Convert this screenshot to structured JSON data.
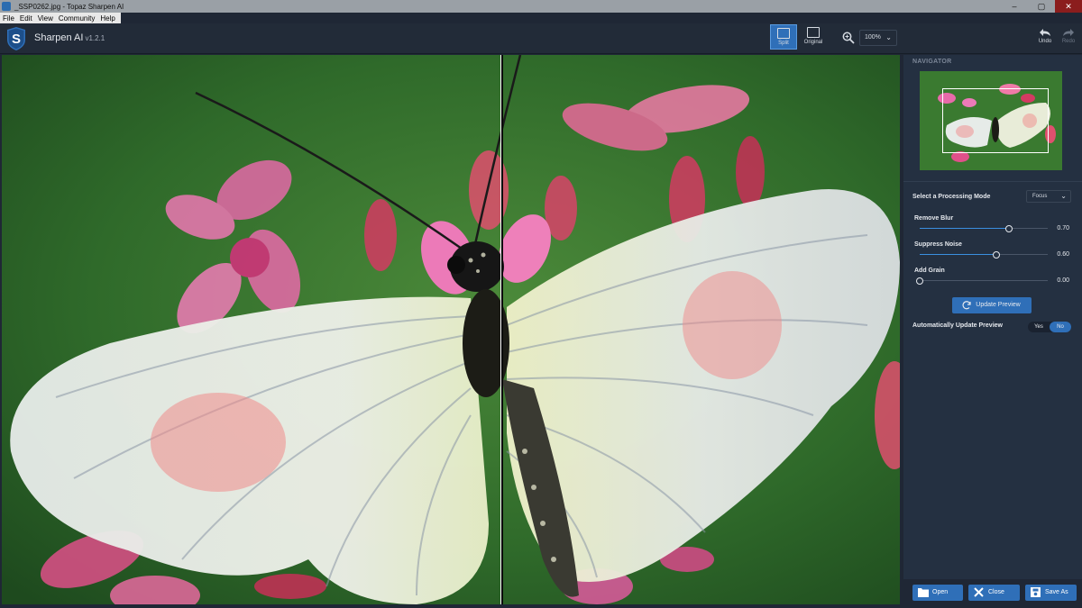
{
  "window": {
    "title": "_SSP0262.jpg - Topaz Sharpen AI",
    "controls": {
      "minimize": "–",
      "maximize": "▢",
      "close": "✕"
    }
  },
  "menu": [
    "File",
    "Edit",
    "View",
    "Community",
    "Help"
  ],
  "toolbar": {
    "app_name": "Sharpen AI",
    "app_version": "v1.2.1",
    "split_label": "Split",
    "original_label": "Original",
    "zoom_value": "100%",
    "undo_label": "Undo",
    "redo_label": "Redo"
  },
  "panel": {
    "navigator_title": "NAVIGATOR",
    "mode_label": "Select a Processing Mode",
    "mode_value": "Focus",
    "sliders": [
      {
        "label": "Remove Blur",
        "value": "0.70",
        "level": 0.7
      },
      {
        "label": "Suppress Noise",
        "value": "0.60",
        "level": 0.6
      },
      {
        "label": "Add Grain",
        "value": "0.00",
        "level": 0.0
      }
    ],
    "update_button": "Update Preview",
    "auto_update_label": "Automatically Update Preview",
    "toggle_yes": "Yes",
    "toggle_no": "No",
    "toggle_selected": "No"
  },
  "footer": {
    "open_label": "Open",
    "close_label": "Close",
    "save_as_label": "Save As"
  },
  "colors": {
    "accent": "#2f6fb8",
    "panel_bg": "#243041",
    "toolbar_bg": "#222b38"
  }
}
